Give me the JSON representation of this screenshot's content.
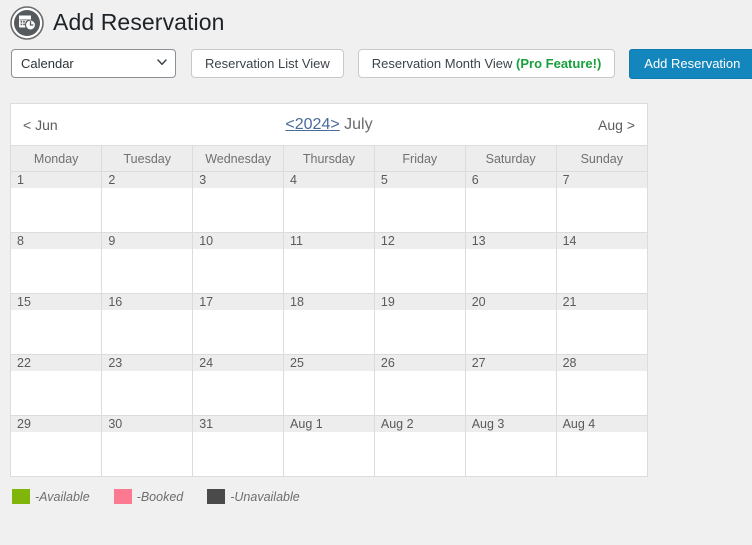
{
  "header": {
    "icon": "calendar-clock-icon",
    "title": "Add Reservation"
  },
  "toolbar": {
    "view_select": {
      "name": "view-select",
      "value": "Calendar",
      "options": [
        "Calendar"
      ]
    },
    "list_view_label": "Reservation List View",
    "month_view_label": "Reservation Month View ",
    "month_view_pro_label": "(Pro Feature!)",
    "add_reservation_label": "Add Reservation",
    "primary_color": "#1386bd",
    "pro_color": "#17a03b"
  },
  "calendar": {
    "nav": {
      "prev_label": "< Jun",
      "year_prev": "<",
      "year": "2024",
      "year_next": ">",
      "month": "July",
      "next_label": "Aug >"
    },
    "weekdays": [
      "Monday",
      "Tuesday",
      "Wednesday",
      "Thursday",
      "Friday",
      "Saturday",
      "Sunday"
    ],
    "weeks": [
      [
        "1",
        "2",
        "3",
        "4",
        "5",
        "6",
        "7"
      ],
      [
        "8",
        "9",
        "10",
        "11",
        "12",
        "13",
        "14"
      ],
      [
        "15",
        "16",
        "17",
        "18",
        "19",
        "20",
        "21"
      ],
      [
        "22",
        "23",
        "24",
        "25",
        "26",
        "27",
        "28"
      ],
      [
        "29",
        "30",
        "31",
        "Aug 1",
        "Aug 2",
        "Aug 3",
        "Aug 4"
      ]
    ]
  },
  "legend": {
    "items": [
      {
        "label": "-Available",
        "color": "#80b50a"
      },
      {
        "label": "-Booked",
        "color": "#fb7a92"
      },
      {
        "label": "-Unavailable",
        "color": "#4a4a4a"
      }
    ]
  }
}
